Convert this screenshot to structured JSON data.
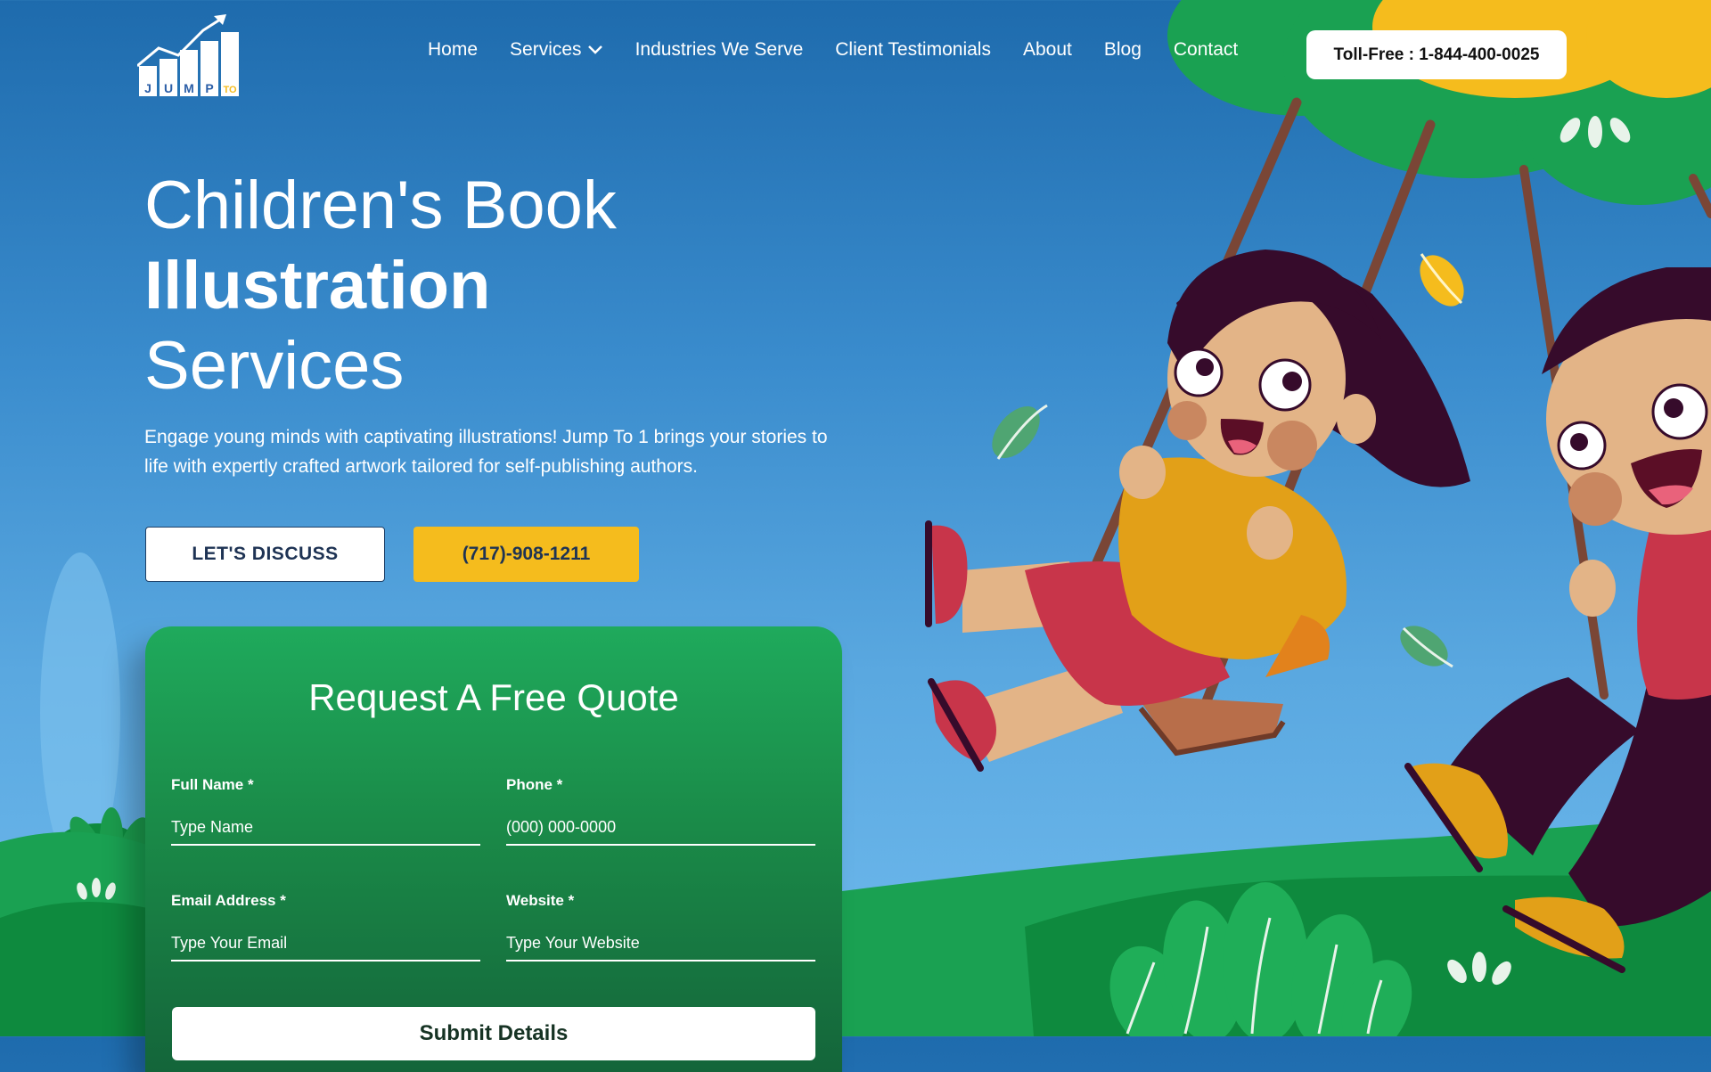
{
  "header": {
    "logo_letters": [
      "J",
      "U",
      "M",
      "P",
      "TO"
    ],
    "nav": [
      {
        "label": "Home"
      },
      {
        "label": "Services",
        "has_dropdown": true
      },
      {
        "label": "Industries We Serve"
      },
      {
        "label": "Client Testimonials"
      },
      {
        "label": "About"
      },
      {
        "label": "Blog"
      },
      {
        "label": "Contact"
      }
    ],
    "tollfree": "Toll-Free : 1-844-400-0025"
  },
  "hero": {
    "title_line1": "Children's Book",
    "title_line2": "Illustration",
    "title_line3": "Services",
    "description": "Engage young minds with captivating illustrations! Jump To 1 brings your stories to life with expertly crafted artwork tailored for self-publishing authors.",
    "discuss_label": "LET'S DISCUSS",
    "phone_label": "(717)-908-1211"
  },
  "form": {
    "title": "Request A Free Quote",
    "fields": [
      {
        "label": "Full Name *",
        "placeholder": "Type Name"
      },
      {
        "label": "Phone *",
        "placeholder": "(000) 000-0000"
      },
      {
        "label": "Email Address *",
        "placeholder": "Type Your Email"
      },
      {
        "label": "Website *",
        "placeholder": "Type Your Website"
      }
    ],
    "submit_label": "Submit Details"
  },
  "colors": {
    "sky_top": "#1e6bad",
    "sky_bottom": "#70bbee",
    "accent_yellow": "#f5bc1d",
    "form_green": "#1faa5c",
    "grass_green": "#0e8a3e"
  }
}
